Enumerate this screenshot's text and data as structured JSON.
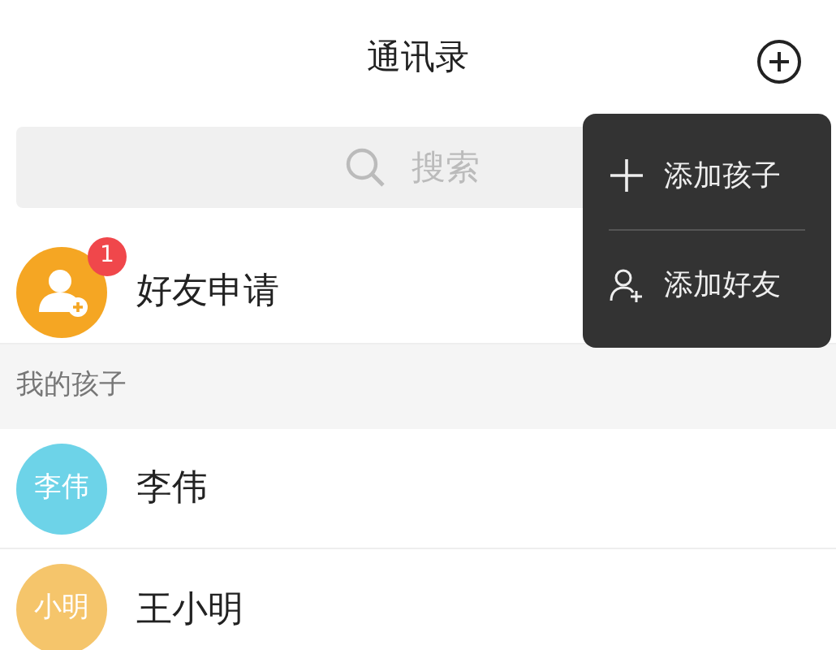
{
  "header": {
    "title": "通讯录"
  },
  "search": {
    "placeholder": "搜索"
  },
  "friend_request": {
    "label": "好友申请",
    "badge": "1"
  },
  "section": {
    "title": "我的孩子"
  },
  "contacts": [
    {
      "avatar_text": "李伟",
      "name": "李伟",
      "color": "#6dd3e8"
    },
    {
      "avatar_text": "小明",
      "name": "王小明",
      "color": "#f5c56b"
    }
  ],
  "menu": [
    {
      "kind": "plus",
      "label": "添加孩子"
    },
    {
      "kind": "person",
      "label": "添加好友"
    }
  ]
}
